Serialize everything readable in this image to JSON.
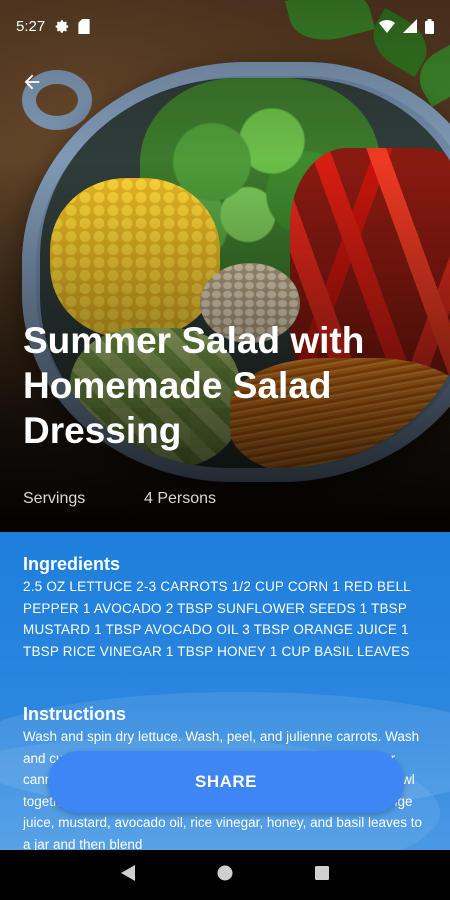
{
  "status_bar": {
    "time": "5:27",
    "icons_left": [
      "settings-icon",
      "sim-card-icon"
    ],
    "icons_right": [
      "wifi-icon",
      "signal-icon",
      "battery-icon"
    ]
  },
  "header": {
    "back_icon": "arrow-left-icon"
  },
  "recipe": {
    "title": "Summer Salad with Homemade Salad Dressing",
    "servings_label": "Servings",
    "servings_value": "4 Persons"
  },
  "ingredients": {
    "heading": "Ingredients",
    "text": "2.5 OZ LETTUCE 2-3  CARROTS 1/2 CUP CORN 1  RED BELL PEPPER 1  AVOCADO 2 TBSP SUNFLOWER SEEDS 1 TBSP MUSTARD 1 TBSP AVOCADO OIL 3 TBSP ORANGE JUICE 1 TBSP RICE VINEGAR 1 TBSP HONEY 1 CUP BASIL LEAVES"
  },
  "instructions": {
    "heading": "Instructions",
    "text": "Wash and spin dry lettuce. Wash, peel, and julienne carrots. Wash and cut the red bell pepper into strips. Prepare the corn (either canned or cooked). Slice the avocado and spread it over the bowl together with the sunflower seeds. For the vinaigrette add orange juice, mustard, avocado oil, rice vinegar, honey, and basil leaves to a jar and then blend"
  },
  "share_button": {
    "label": "SHARE"
  },
  "nav_bar": {
    "icons": [
      "back-triangle-icon",
      "home-circle-icon",
      "recents-square-icon"
    ]
  },
  "colors": {
    "content_blue": "#1d7fdc",
    "share_blue": "#3d86f4"
  }
}
